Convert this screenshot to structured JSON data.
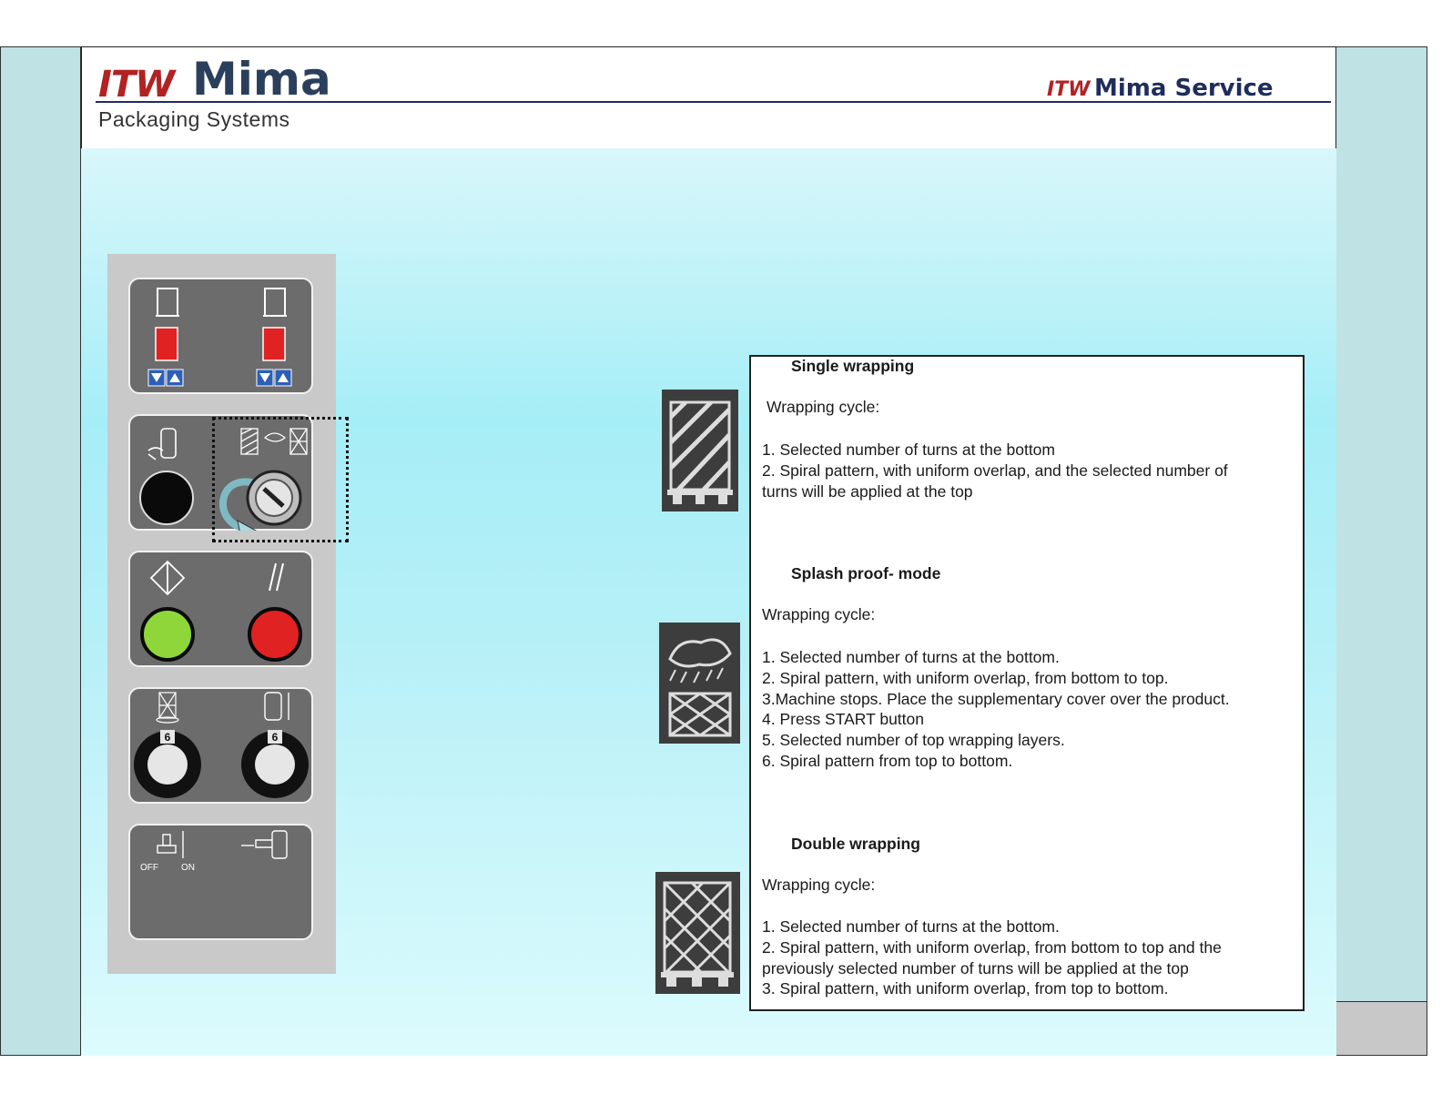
{
  "header": {
    "logo_prefix": "ITW",
    "logo_name": "Mima",
    "logo_subtitle": "Packaging Systems",
    "service_prefix": "ITW",
    "service_name": "Mima Service"
  },
  "panel": {
    "off_label": "OFF",
    "on_label": "ON",
    "dial_left_value": "6",
    "dial_right_value": "6",
    "colors": {
      "start": "#8fd63a",
      "stop": "#e02222",
      "indicator": "#e02222",
      "arrow": "#2b5fb8"
    }
  },
  "sections": [
    {
      "title": "Single wrapping",
      "cycle_label": "Wrapping cycle:",
      "lines": [
        "1. Selected number of turns at the bottom",
        "2. Spiral pattern, with uniform overlap, and the selected number of",
        "turns will be applied at the top"
      ],
      "icon": "diagonal-wrap-icon"
    },
    {
      "title": "Splash proof- mode",
      "cycle_label": "Wrapping cycle:",
      "lines": [
        "1. Selected number of turns at the bottom.",
        "2. Spiral pattern, with uniform overlap, from bottom to top.",
        "3.Machine stops. Place the supplementary cover over the product.",
        "4. Press START button",
        "5. Selected number of top wrapping layers.",
        "6. Spiral pattern from top to bottom."
      ],
      "icon": "splash-proof-icon"
    },
    {
      "title": "Double wrapping",
      "cycle_label": "Wrapping cycle:",
      "lines": [
        "1. Selected number of turns at the bottom.",
        "2. Spiral pattern, with uniform overlap, from bottom to top and the",
        "previously selected number of turns will be applied at the top",
        "3. Spiral pattern, with uniform overlap, from top to bottom."
      ],
      "icon": "crosshatch-wrap-icon"
    }
  ]
}
